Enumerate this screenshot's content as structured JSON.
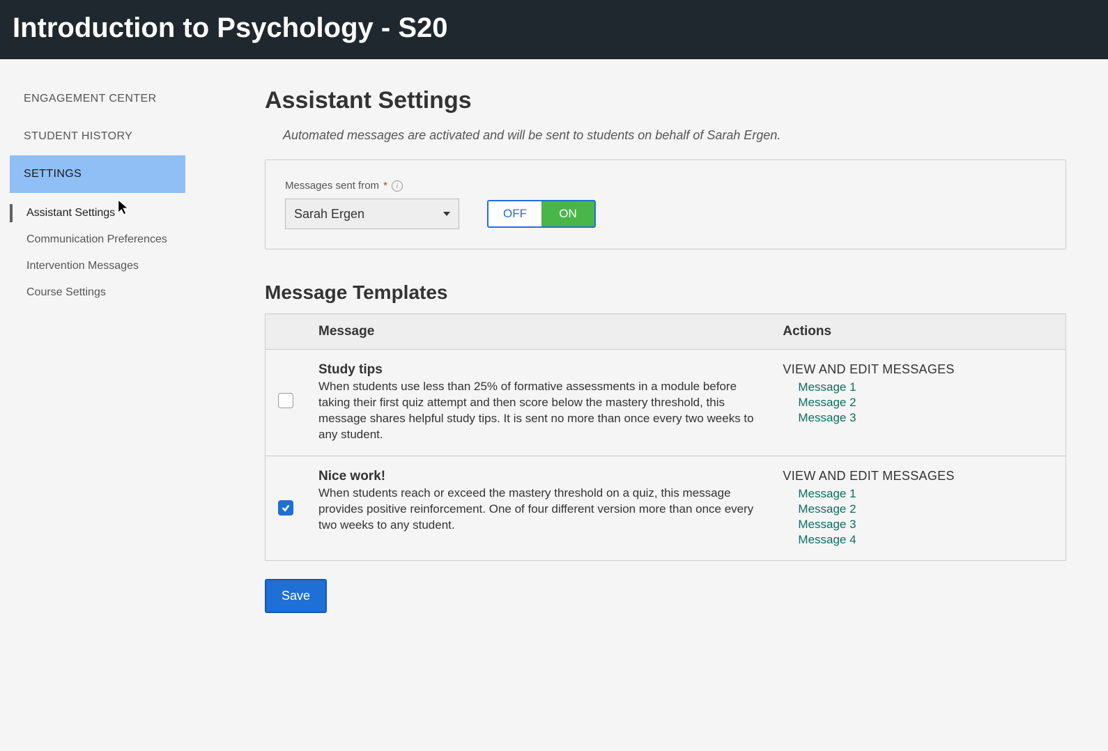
{
  "header": {
    "course_title": "Introduction to Psychology - S20"
  },
  "sidebar": {
    "primary": [
      {
        "label": "ENGAGEMENT CENTER",
        "active": false
      },
      {
        "label": "STUDENT HISTORY",
        "active": false
      },
      {
        "label": "SETTINGS",
        "active": true
      }
    ],
    "sub": [
      {
        "label": "Assistant Settings",
        "active": true
      },
      {
        "label": "Communication Preferences",
        "active": false
      },
      {
        "label": "Intervention Messages",
        "active": false
      },
      {
        "label": "Course Settings",
        "active": false
      }
    ]
  },
  "main": {
    "title": "Assistant Settings",
    "description": "Automated messages are activated and will be sent to students on behalf of Sarah Ergen.",
    "sender": {
      "label": "Messages sent from",
      "required_marker": "*",
      "selected": "Sarah Ergen",
      "toggle": {
        "off_label": "OFF",
        "on_label": "ON",
        "state": "on"
      }
    },
    "templates": {
      "section_title": "Message Templates",
      "columns": {
        "message": "Message",
        "actions": "Actions"
      },
      "view_edit_label": "VIEW AND EDIT MESSAGES",
      "rows": [
        {
          "checked": false,
          "title": "Study tips",
          "desc": "When students use less than 25% of formative assessments in a module before taking their first quiz attempt and then score below the mastery threshold, this message shares helpful study tips. It is sent no more than once every two weeks to any student.",
          "messages": [
            "Message 1",
            "Message 2",
            "Message 3"
          ]
        },
        {
          "checked": true,
          "title": "Nice work!",
          "desc": "When students reach or exceed the mastery threshold on a quiz, this message provides positive reinforcement. One of four different version more than once every two weeks to any student.",
          "messages": [
            "Message 1",
            "Message 2",
            "Message 3",
            "Message 4"
          ]
        }
      ]
    },
    "save_label": "Save"
  },
  "colors": {
    "accent_blue": "#1e6fd6",
    "accent_green": "#48b648",
    "link_teal": "#0b6e60",
    "nav_highlight": "#8fbff5"
  }
}
